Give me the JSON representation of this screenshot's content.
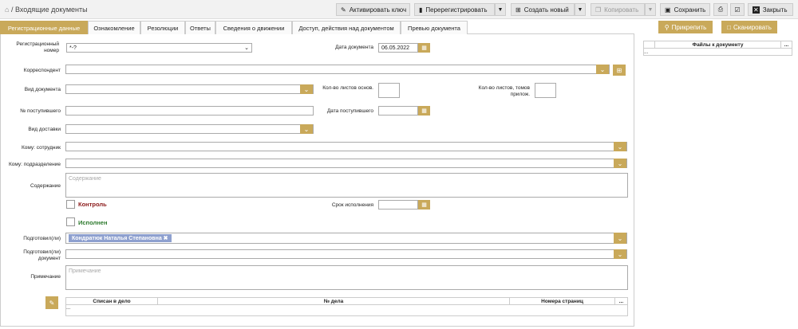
{
  "header": {
    "home_icon": "home-icon",
    "breadcrumb": "/ Входящие документы"
  },
  "toolbar": {
    "activate_key": "Активировать ключ",
    "reregister": "Перерегистрировать",
    "create_new": "Создать новый",
    "copy": "Копировать",
    "save": "Сохранить",
    "close": "Закрыть"
  },
  "tabs": [
    "Регистрационные данные",
    "Ознакомление",
    "Резолюции",
    "Ответы",
    "Сведения о движении",
    "Доступ, действия над документом",
    "Превью документа"
  ],
  "side": {
    "attach": "Прикрепить",
    "scan": "Сканировать",
    "files_header": "Файлы к документу",
    "more": "...",
    "row": "..."
  },
  "form": {
    "reg_number_label": "Регистрационный номер",
    "reg_number_value": "*-?",
    "doc_date_label": "Дата документа",
    "doc_date_value": "06.05.2022",
    "correspondent_label": "Корреспондент",
    "doc_type_label": "Вид документа",
    "sheets_main_label": "Кол-во листов основ.",
    "sheets_attach_label": "Кол-во листов, томов прилож.",
    "incoming_no_label": "№ поступившего",
    "incoming_date_label": "Дата поступившего",
    "delivery_label": "Вид доставки",
    "to_employee_label": "Кому: сотрудник",
    "to_department_label": "Кому: подразделение",
    "content_label": "Содержание",
    "content_placeholder": "Содержание",
    "control_label": "Контроль",
    "deadline_label": "Срок исполнения",
    "done_label": "Исполнен",
    "prepared_label": "Подготовил(ли)",
    "prepared_tag": "Кондратюк Наталья Степановна",
    "prepared_doc_label": "Подготовил(ли) документ",
    "note_label": "Примечание",
    "note_placeholder": "Примечание",
    "case_cols": [
      "Списан в дело",
      "№ дела",
      "Номера страниц",
      "..."
    ],
    "case_row": "..."
  }
}
